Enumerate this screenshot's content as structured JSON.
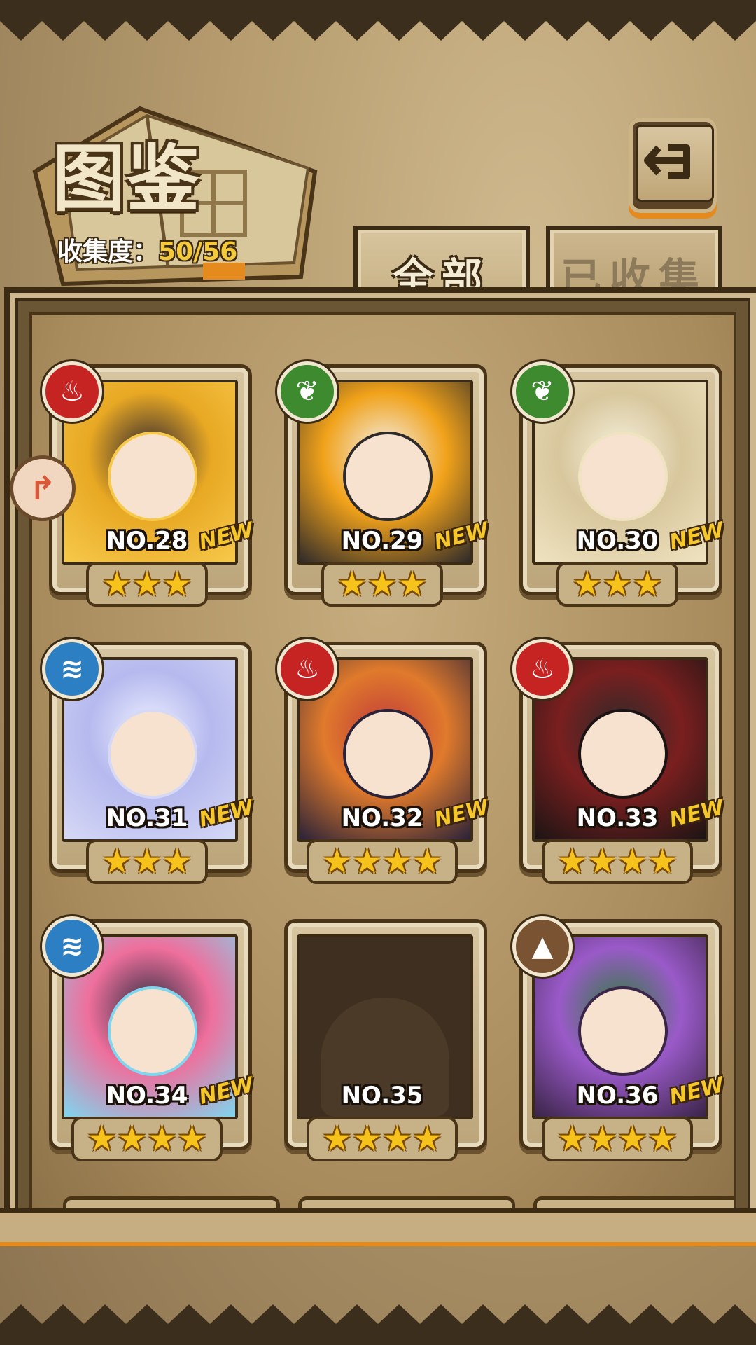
{
  "header": {
    "title": "图鉴",
    "collection_label": "收集度：",
    "collection_value": "50/56",
    "back_icon": "return-arrow-icon"
  },
  "tabs": [
    {
      "label": "全部",
      "active": true
    },
    {
      "label": "已收集",
      "active": false
    }
  ],
  "colors": {
    "accent_orange": "#e58b1e",
    "star_gold": "#f6c21c",
    "new_tag": "#f6c72b",
    "fire": "#c62323",
    "leaf": "#3d8a2f",
    "water": "#2b7fc2",
    "earth": "#7a5332"
  },
  "cards": [
    {
      "no": "NO.28",
      "stars": "★★★",
      "new": "NEW",
      "element": "fire-icon",
      "art": [
        "#f7c94b",
        "#e8a823",
        "#2b2430"
      ]
    },
    {
      "no": "NO.29",
      "stars": "★★★",
      "new": "NEW",
      "element": "leaf-icon",
      "art": [
        "#2e2a2a",
        "#f1a21a",
        "#f2f2f2"
      ]
    },
    {
      "no": "NO.30",
      "stars": "★★★",
      "new": "NEW",
      "element": "leaf-icon",
      "art": [
        "#efe3c0",
        "#d8c79d",
        "#f5f0dd"
      ]
    },
    {
      "no": "NO.31",
      "stars": "★★★",
      "new": "NEW",
      "element": "water-icon",
      "art": [
        "#d6d9f5",
        "#b5b9ee",
        "#eef0ff"
      ]
    },
    {
      "no": "NO.32",
      "stars": "★★★★",
      "new": "NEW",
      "element": "fire-icon",
      "art": [
        "#2a2238",
        "#e07a2c",
        "#c03a3a"
      ]
    },
    {
      "no": "NO.33",
      "stars": "★★★★",
      "new": "NEW",
      "element": "fire-icon",
      "art": [
        "#1c1414",
        "#7a1f1f",
        "#2a2a2a"
      ]
    },
    {
      "no": "NO.34",
      "stars": "★★★★",
      "new": "NEW",
      "element": "water-icon",
      "art": [
        "#7fd6ef",
        "#ef6f9c",
        "#2b2d3f"
      ]
    },
    {
      "no": "NO.35",
      "stars": "★★★★",
      "new": "",
      "element": "",
      "art": []
    },
    {
      "no": "NO.36",
      "stars": "★★★★",
      "new": "NEW",
      "element": "earth-icon",
      "art": [
        "#3a2447",
        "#9a5ac9",
        "#2e7d3a"
      ]
    }
  ],
  "side_badge_icon": "share-arrow-icon"
}
